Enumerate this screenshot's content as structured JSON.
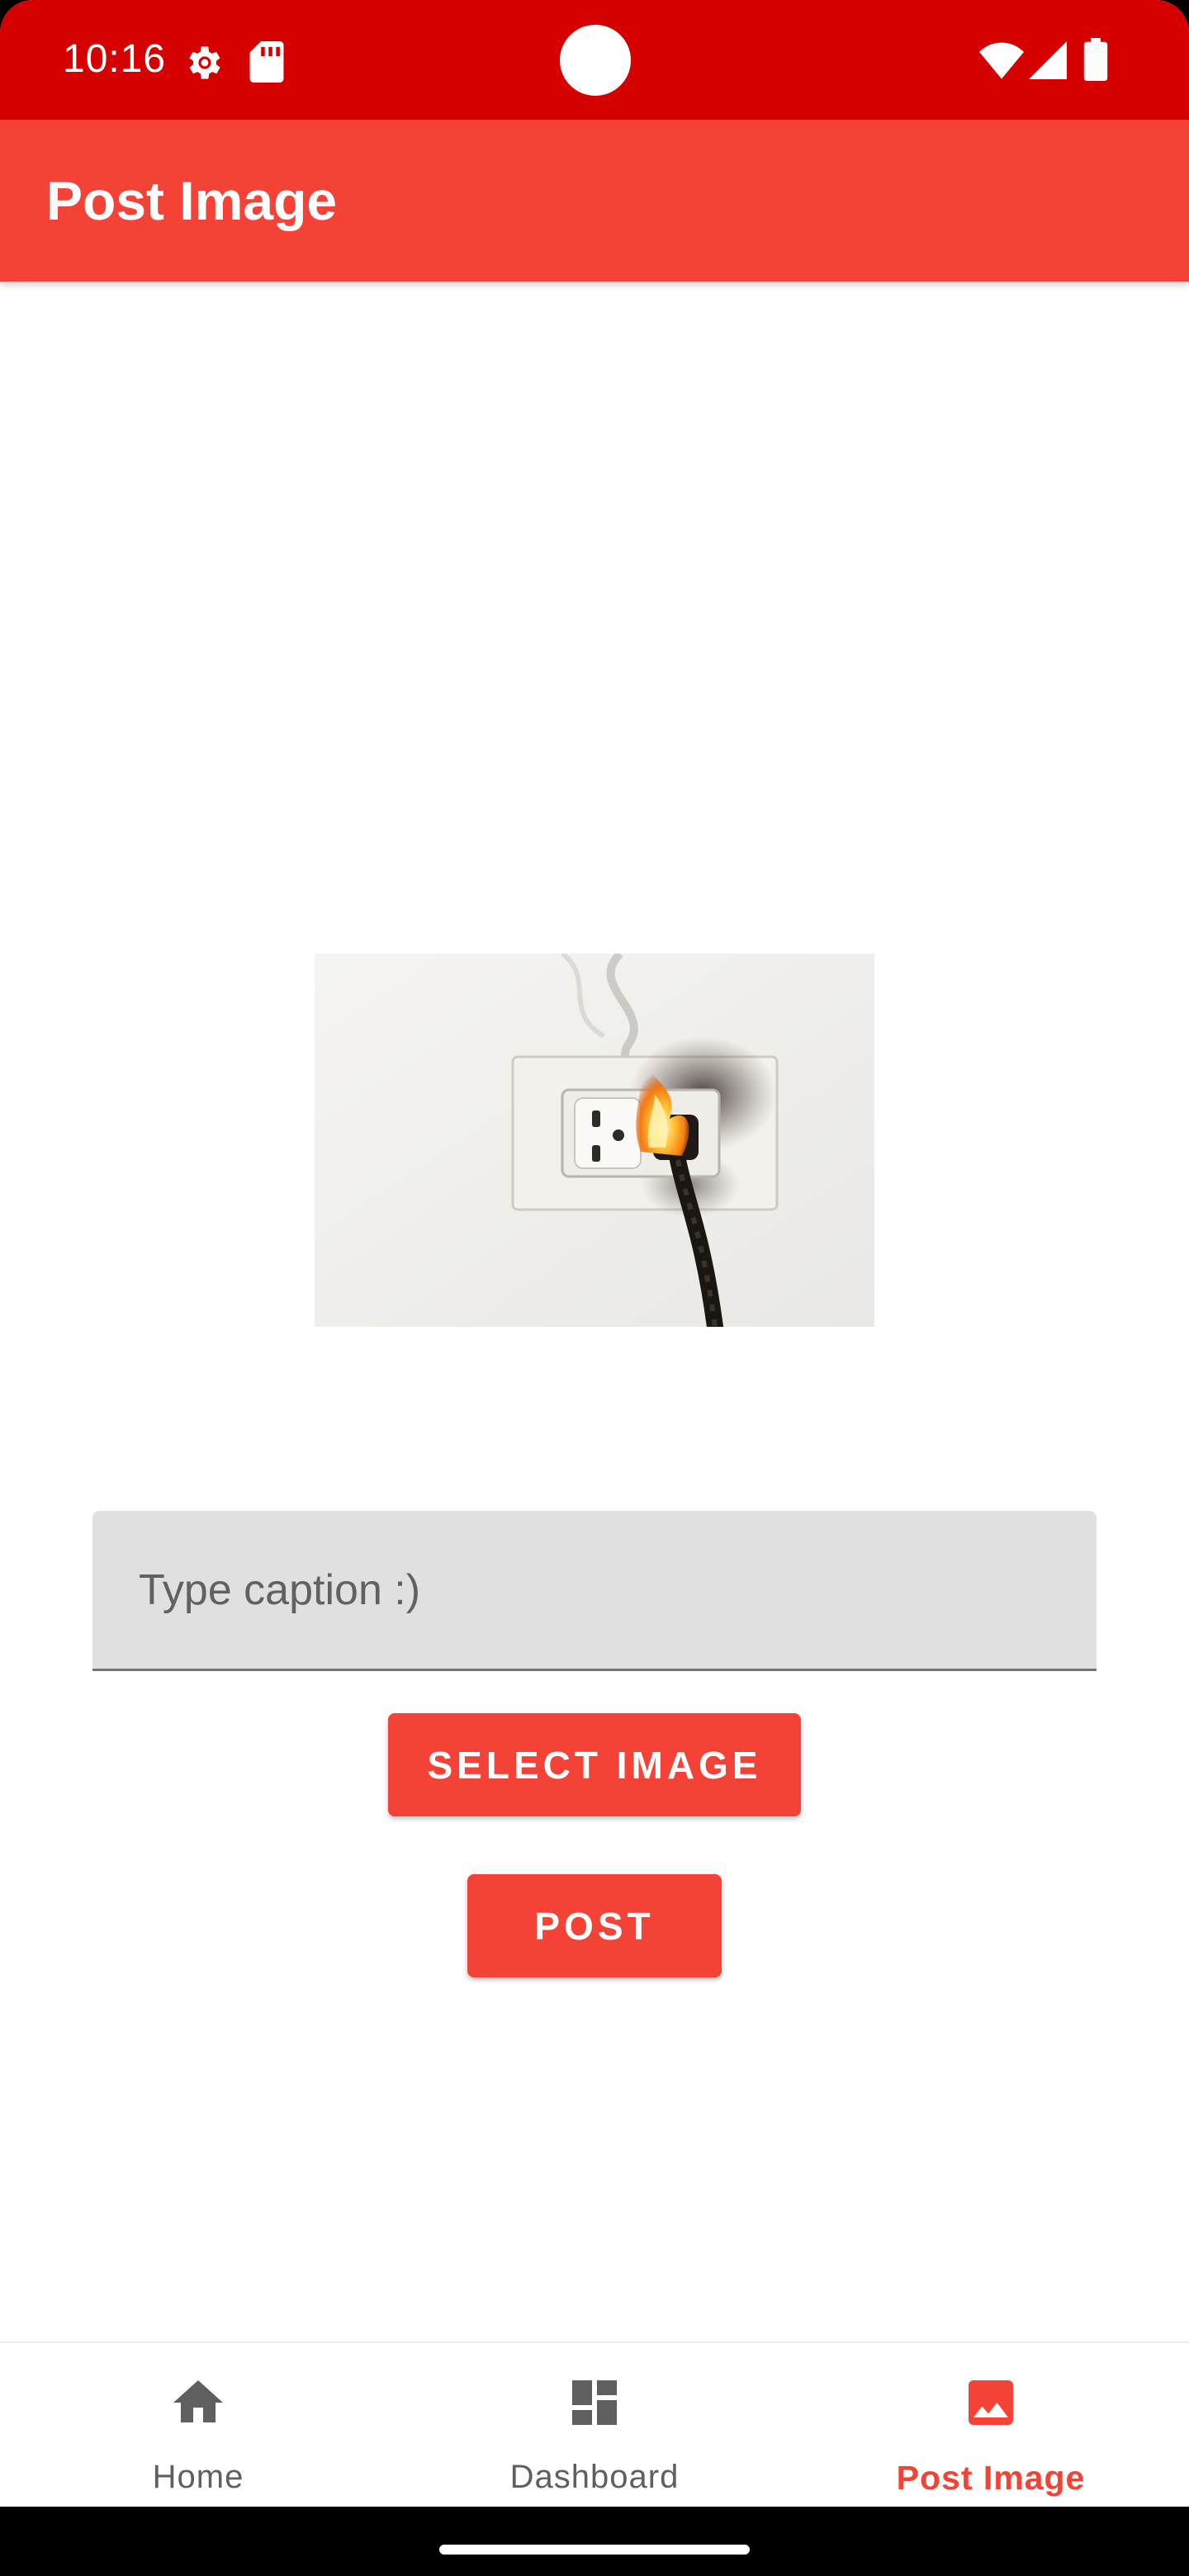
{
  "status_bar": {
    "time": "10:16",
    "icons": [
      "settings-gear-icon",
      "sd-card-icon",
      "wifi-icon",
      "signal-icon",
      "battery-icon"
    ],
    "color": "#d50000"
  },
  "app_bar": {
    "title": "Post Image",
    "color": "#f44336"
  },
  "preview": {
    "description_icon": "burning-power-outlet-image"
  },
  "caption": {
    "value": "",
    "placeholder": "Type caption :)"
  },
  "buttons": {
    "select_image": "SELECT IMAGE",
    "post": "POST"
  },
  "bottom_nav": {
    "items": [
      {
        "label": "Home",
        "icon": "home-icon",
        "active": false
      },
      {
        "label": "Dashboard",
        "icon": "dashboard-icon",
        "active": false
      },
      {
        "label": "Post Image",
        "icon": "image-icon",
        "active": true
      }
    ],
    "active_color": "#f44336",
    "inactive_color": "#5f5f5f"
  }
}
